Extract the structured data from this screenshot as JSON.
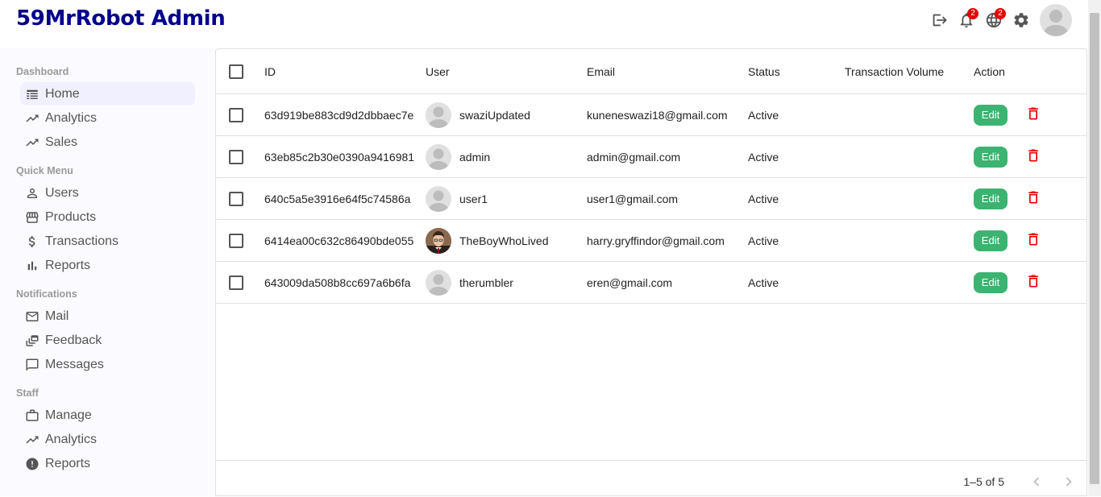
{
  "app": {
    "title": "59MrRobot Admin"
  },
  "topbar": {
    "notifications_badge": "2",
    "language_badge": "2"
  },
  "sidebar": {
    "sections": [
      {
        "title": "Dashboard",
        "items": [
          {
            "label": "Home",
            "icon": "home-icon",
            "active": true
          },
          {
            "label": "Analytics",
            "icon": "trending-icon"
          },
          {
            "label": "Sales",
            "icon": "trending-icon"
          }
        ]
      },
      {
        "title": "Quick Menu",
        "items": [
          {
            "label": "Users",
            "icon": "person-icon"
          },
          {
            "label": "Products",
            "icon": "storefront-icon"
          },
          {
            "label": "Transactions",
            "icon": "dollar-icon"
          },
          {
            "label": "Reports",
            "icon": "bar-chart-icon"
          }
        ]
      },
      {
        "title": "Notifications",
        "items": [
          {
            "label": "Mail",
            "icon": "mail-icon"
          },
          {
            "label": "Feedback",
            "icon": "dynamic-feed-icon"
          },
          {
            "label": "Messages",
            "icon": "chat-bubble-icon"
          }
        ]
      },
      {
        "title": "Staff",
        "items": [
          {
            "label": "Manage",
            "icon": "work-icon"
          },
          {
            "label": "Analytics",
            "icon": "timeline-icon"
          },
          {
            "label": "Reports",
            "icon": "report-icon"
          }
        ]
      }
    ]
  },
  "table": {
    "headers": {
      "id": "ID",
      "user": "User",
      "email": "Email",
      "status": "Status",
      "volume": "Transaction Volume",
      "action": "Action"
    },
    "rows": [
      {
        "id": "63d919be883cd9d2dbbaec7e",
        "user": "swaziUpdated",
        "email": "kuneneswazi18@gmail.com",
        "status": "Active",
        "volume": "",
        "photo": false
      },
      {
        "id": "63eb85c2b30e0390a9416981",
        "user": "admin",
        "email": "admin@gmail.com",
        "status": "Active",
        "volume": "",
        "photo": false
      },
      {
        "id": "640c5a5e3916e64f5c74586a",
        "user": "user1",
        "email": "user1@gmail.com",
        "status": "Active",
        "volume": "",
        "photo": false
      },
      {
        "id": "6414ea00c632c86490bde055",
        "user": "TheBoyWhoLived",
        "email": "harry.gryffindor@gmail.com",
        "status": "Active",
        "volume": "",
        "photo": true
      },
      {
        "id": "643009da508b8cc697a6b6fa",
        "user": "therumbler",
        "email": "eren@gmail.com",
        "status": "Active",
        "volume": "",
        "photo": false
      }
    ],
    "edit_label": "Edit",
    "pagination": "1–5 of 5"
  },
  "colors": {
    "brand": "#00008b",
    "edit": "#3cb371",
    "delete": "#e60000",
    "badge": "#e60000"
  }
}
